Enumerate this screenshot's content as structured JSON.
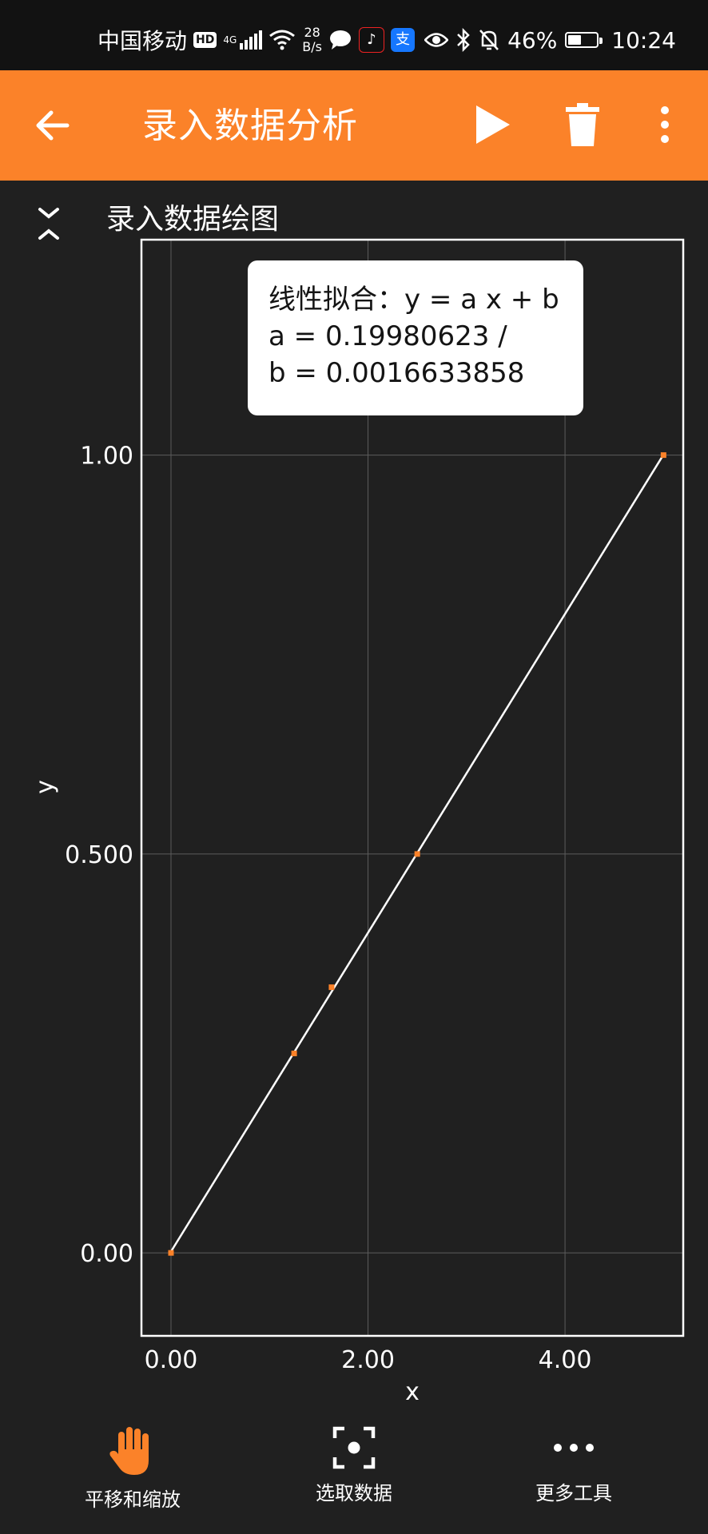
{
  "status_bar": {
    "carrier": "中国移动",
    "hd": "HD",
    "network": "4G",
    "speed_value": "28",
    "speed_unit": "B/s",
    "battery_percent": "46%",
    "battery_level": 0.46,
    "time": "10:24"
  },
  "app_bar": {
    "title": "录入数据分析"
  },
  "section": {
    "title": "录入数据绘图"
  },
  "fit_box": {
    "line1": "线性拟合：y = a x + b",
    "line2": "a = 0.19980623 /",
    "line3": "b = 0.0016633858"
  },
  "chart_data": {
    "type": "scatter",
    "xlabel": "x",
    "ylabel": "y",
    "x_ticks": [
      "0.00",
      "2.00",
      "4.00"
    ],
    "y_ticks": [
      "1.00",
      "0.500",
      "0.00"
    ],
    "xlim": [
      -0.3,
      5.2
    ],
    "ylim": [
      -0.104,
      1.27
    ],
    "grid": true,
    "points": [
      {
        "x": 0.0,
        "y": 0.0
      },
      {
        "x": 1.25,
        "y": 0.25
      },
      {
        "x": 1.63,
        "y": 0.333
      },
      {
        "x": 2.5,
        "y": 0.5
      },
      {
        "x": 5.0,
        "y": 1.0
      }
    ],
    "fit": {
      "a": 0.19980623,
      "b": 0.0016633858,
      "x_range": [
        0.0,
        5.0
      ]
    },
    "colors": {
      "point": "#fb8229",
      "line": "#ffffff",
      "grid": "#5c5c5c",
      "frame": "#ffffff"
    }
  },
  "bottom_nav": {
    "items": [
      {
        "label": "平移和缩放",
        "icon": "hand-icon"
      },
      {
        "label": "选取数据",
        "icon": "select-data-icon"
      },
      {
        "label": "更多工具",
        "icon": "more-horiz-icon"
      }
    ]
  },
  "colors": {
    "accent": "#fb8229",
    "background": "#202020",
    "status_bar": "#121212"
  }
}
